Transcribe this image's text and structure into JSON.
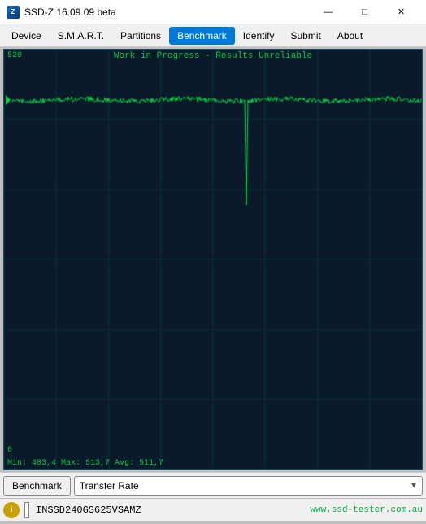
{
  "titleBar": {
    "icon": "Z",
    "title": "SSD-Z 16.09.09 beta",
    "minimize": "—",
    "maximize": "□",
    "close": "✕"
  },
  "menuBar": {
    "items": [
      {
        "label": "Device",
        "active": false
      },
      {
        "label": "S.M.A.R.T.",
        "active": false
      },
      {
        "label": "Partitions",
        "active": false
      },
      {
        "label": "Benchmark",
        "active": true
      },
      {
        "label": "Identify",
        "active": false
      },
      {
        "label": "Submit",
        "active": false
      },
      {
        "label": "About",
        "active": false
      }
    ]
  },
  "chart": {
    "workInProgress": "Work in Progress - Results Unreliable",
    "yTop": "520",
    "yBottom": "0",
    "statsLabel": "Min: 483,4  Max: 513,7  Avg: 511,7"
  },
  "bottomBar": {
    "benchmarkButton": "Benchmark",
    "dropdownValue": "Transfer Rate",
    "dropdownArrow": "▼"
  },
  "statusBar": {
    "driveName": "INSSD240GS625VSAMZ",
    "url": "www.ssd-tester.com.au"
  }
}
